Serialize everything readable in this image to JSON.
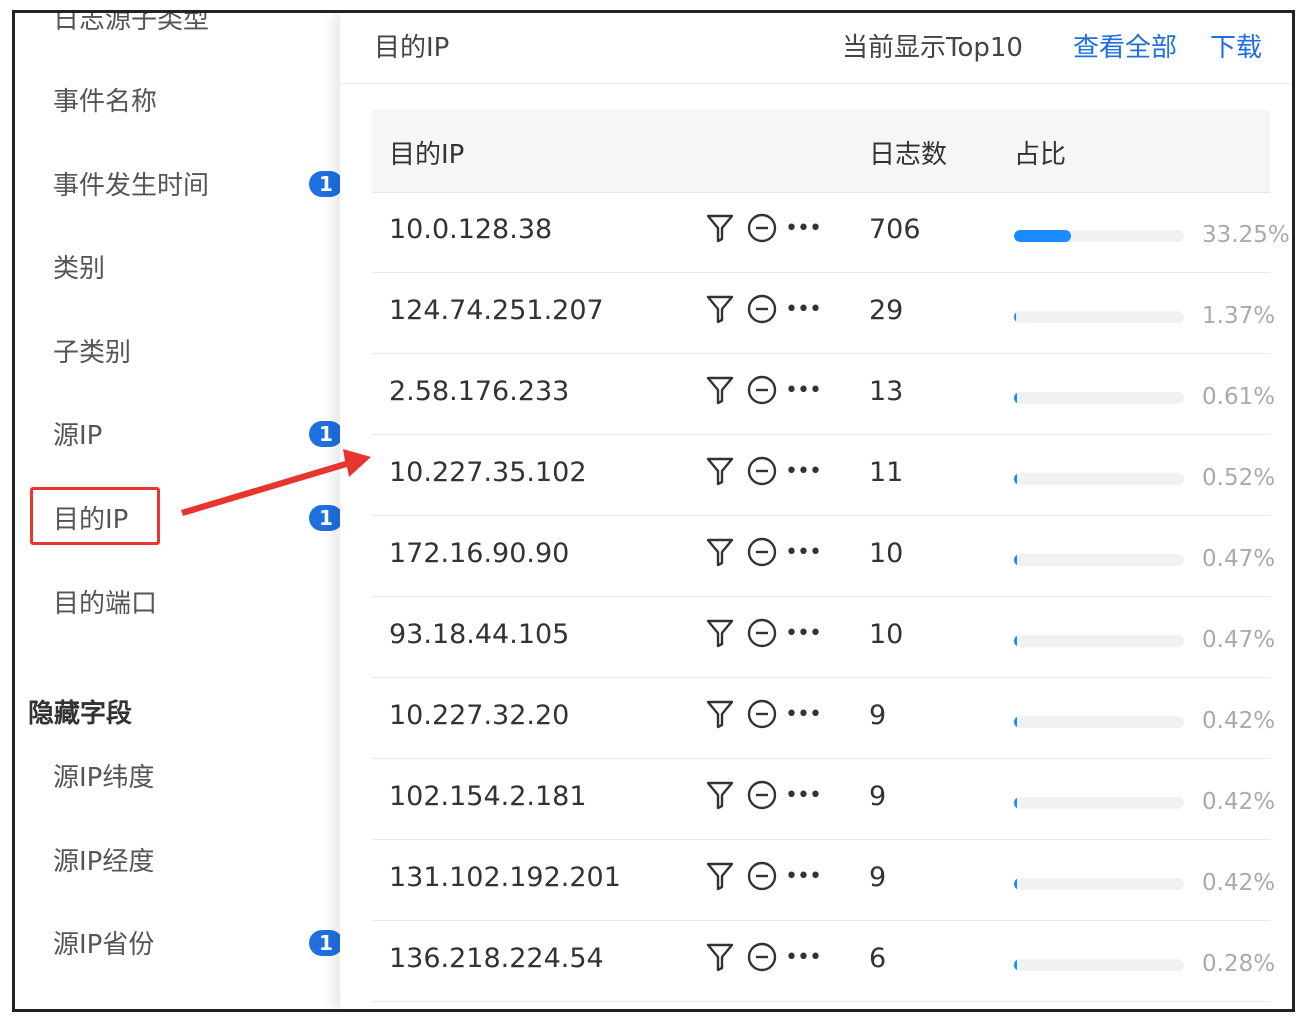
{
  "sidebar": {
    "items": [
      {
        "label": "日志源子类型",
        "badge": ""
      },
      {
        "label": "事件名称",
        "badge": ""
      },
      {
        "label": "事件发生时间",
        "badge": "1"
      },
      {
        "label": "类别",
        "badge": ""
      },
      {
        "label": "子类别",
        "badge": ""
      },
      {
        "label": "源IP",
        "badge": "1"
      },
      {
        "label": "目的IP",
        "badge": "1"
      },
      {
        "label": "目的端口",
        "badge": ""
      }
    ],
    "hidden_section_title": "隐藏字段",
    "hidden_items": [
      {
        "label": "源IP纬度",
        "badge": ""
      },
      {
        "label": "源IP经度",
        "badge": ""
      },
      {
        "label": "源IP省份",
        "badge": "1"
      }
    ]
  },
  "panel": {
    "title": "目的IP",
    "top_info": "当前显示Top10",
    "view_all": "查看全部",
    "download": "下载",
    "columns": {
      "ip": "目的IP",
      "count": "日志数",
      "ratio": "占比"
    },
    "rows": [
      {
        "ip": "10.0.128.38",
        "count": "706",
        "ratio": "33.25%",
        "fraction": 0.3325
      },
      {
        "ip": "124.74.251.207",
        "count": "29",
        "ratio": "1.37%",
        "fraction": 0.0137
      },
      {
        "ip": "2.58.176.233",
        "count": "13",
        "ratio": "0.61%",
        "fraction": 0.0061
      },
      {
        "ip": "10.227.35.102",
        "count": "11",
        "ratio": "0.52%",
        "fraction": 0.0052
      },
      {
        "ip": "172.16.90.90",
        "count": "10",
        "ratio": "0.47%",
        "fraction": 0.0047
      },
      {
        "ip": "93.18.44.105",
        "count": "10",
        "ratio": "0.47%",
        "fraction": 0.0047
      },
      {
        "ip": "10.227.32.20",
        "count": "9",
        "ratio": "0.42%",
        "fraction": 0.0042
      },
      {
        "ip": "102.154.2.181",
        "count": "9",
        "ratio": "0.42%",
        "fraction": 0.0042
      },
      {
        "ip": "131.102.192.201",
        "count": "9",
        "ratio": "0.42%",
        "fraction": 0.0042
      },
      {
        "ip": "136.218.224.54",
        "count": "6",
        "ratio": "0.28%",
        "fraction": 0.0028
      }
    ]
  },
  "colors": {
    "accent": "#1f6fe0",
    "bar": "#1a8cff",
    "highlight": "#e8352f"
  }
}
